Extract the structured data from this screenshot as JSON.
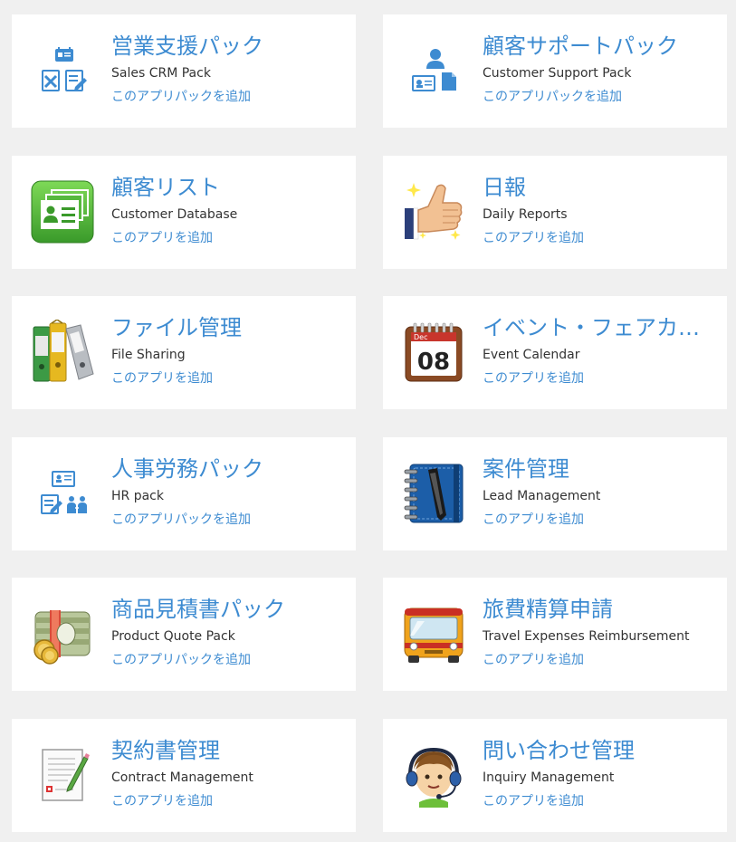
{
  "colors": {
    "background": "#f0f0f0",
    "card": "#ffffff",
    "accent": "#3d8bd1",
    "text": "#333333"
  },
  "cards": [
    {
      "title": "営業支援パック",
      "subtitle": "Sales CRM Pack",
      "add_label": "このアプリパックを追加",
      "icon": "sales-crm-pack-icon"
    },
    {
      "title": "顧客サポートパック",
      "subtitle": "Customer Support Pack",
      "add_label": "このアプリパックを追加",
      "icon": "customer-support-pack-icon"
    },
    {
      "title": "顧客リスト",
      "subtitle": "Customer Database",
      "add_label": "このアプリを追加",
      "icon": "customer-card-icon"
    },
    {
      "title": "日報",
      "subtitle": "Daily Reports",
      "add_label": "このアプリを追加",
      "icon": "thumbs-up-icon"
    },
    {
      "title": "ファイル管理",
      "subtitle": "File Sharing",
      "add_label": "このアプリを追加",
      "icon": "binders-icon"
    },
    {
      "title": "イベント・フェアカ…",
      "subtitle": "Event Calendar",
      "add_label": "このアプリを追加",
      "icon": "calendar-icon",
      "calendar_month": "Dec",
      "calendar_day": "08"
    },
    {
      "title": "人事労務パック",
      "subtitle": "HR pack",
      "add_label": "このアプリパックを追加",
      "icon": "hr-pack-icon"
    },
    {
      "title": "案件管理",
      "subtitle": "Lead Management",
      "add_label": "このアプリを追加",
      "icon": "notebook-pen-icon"
    },
    {
      "title": "商品見積書パック",
      "subtitle": "Product Quote Pack",
      "add_label": "このアプリパックを追加",
      "icon": "money-icon"
    },
    {
      "title": "旅費精算申請",
      "subtitle": "Travel Expenses Reimbursement",
      "add_label": "このアプリを追加",
      "icon": "bus-icon"
    },
    {
      "title": "契約書管理",
      "subtitle": "Contract Management",
      "add_label": "このアプリを追加",
      "icon": "contract-icon"
    },
    {
      "title": "問い合わせ管理",
      "subtitle": "Inquiry Management",
      "add_label": "このアプリを追加",
      "icon": "headset-operator-icon"
    }
  ]
}
